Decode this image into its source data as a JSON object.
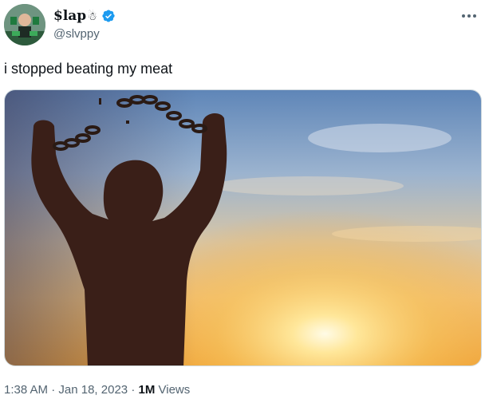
{
  "user": {
    "display_name": "$lap",
    "name_emoji": "☃",
    "handle": "@slvppy",
    "verified": true
  },
  "menu": {
    "more_icon": "ellipsis-icon"
  },
  "tweet": {
    "text": "i stopped beating my meat"
  },
  "footer": {
    "time": "1:38 AM",
    "separator": "·",
    "date": "Jan 18, 2023",
    "views_count": "1M",
    "views_label": "Views"
  },
  "colors": {
    "verified": "#1d9bf0",
    "secondary_text": "#536471",
    "primary_text": "#0f1419"
  }
}
